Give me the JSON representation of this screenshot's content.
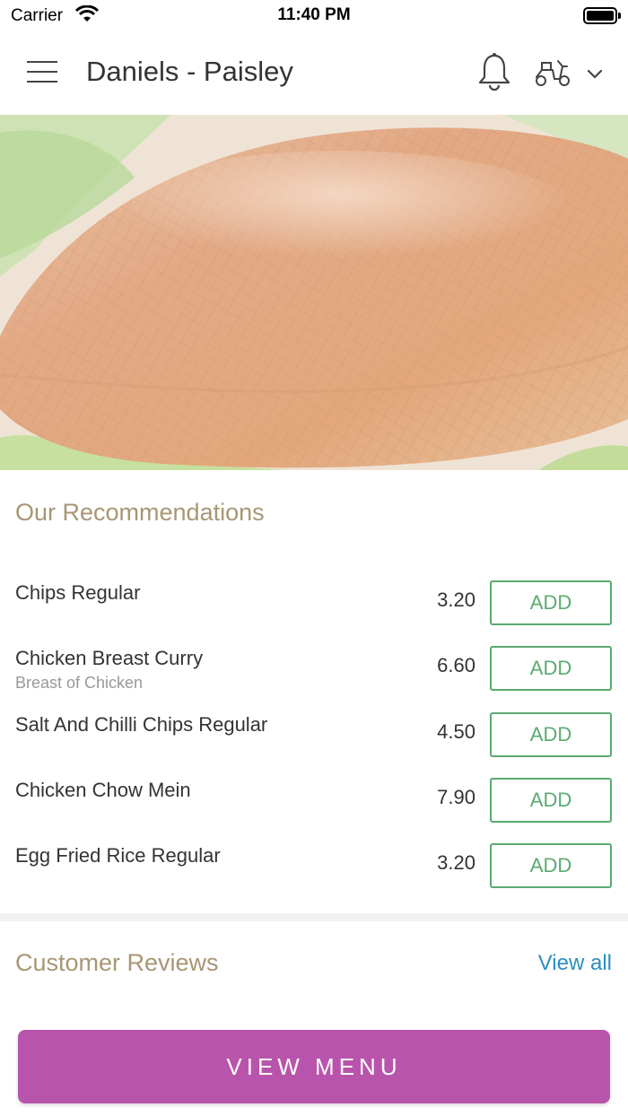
{
  "status_bar": {
    "carrier": "Carrier",
    "time": "11:40 PM"
  },
  "header": {
    "title": "Daniels - Paisley",
    "icons": [
      "menu-icon",
      "bell-icon",
      "scooter-icon",
      "chevron-down-icon"
    ]
  },
  "recommendations": {
    "title": "Our Recommendations",
    "add_label": "ADD",
    "items": [
      {
        "name": "Chips Regular",
        "description": "",
        "price": "3.20"
      },
      {
        "name": "Chicken Breast Curry",
        "description": "Breast of Chicken",
        "price": "6.60"
      },
      {
        "name": "Salt And Chilli Chips Regular",
        "description": "",
        "price": "4.50"
      },
      {
        "name": "Chicken Chow Mein",
        "description": "",
        "price": "7.90"
      },
      {
        "name": "Egg Fried Rice Regular",
        "description": "",
        "price": "3.20"
      }
    ]
  },
  "reviews": {
    "title": "Customer Reviews",
    "view_all": "View all"
  },
  "footer": {
    "view_menu": "VIEW MENU"
  },
  "colors": {
    "accent_purple": "#b954ac",
    "add_green": "#5aaa70",
    "section_title": "#a89674",
    "link_blue": "#2a8fbf"
  }
}
